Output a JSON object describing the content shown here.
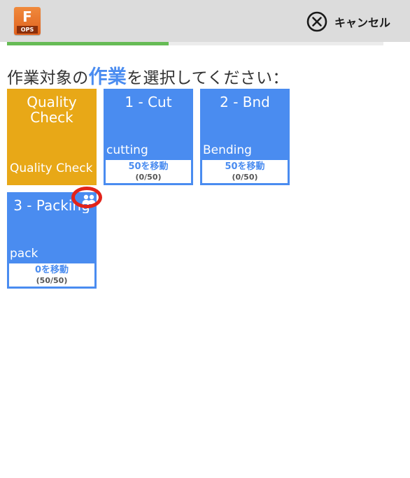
{
  "header": {
    "logo": {
      "letter": "F",
      "badge": "OPS"
    },
    "cancel_label": "キャンセル",
    "cancel_icon": "close-circle-icon"
  },
  "progress": {
    "fraction": 0.43,
    "color": "#66bb55"
  },
  "prompt": {
    "before": "作業対象の",
    "emphasis": "作業",
    "after": "を選択してください："
  },
  "tiles": [
    {
      "title": "Quality Check",
      "subtitle": "Quality Check",
      "move_label": "",
      "count": "",
      "color": "#e8a817"
    },
    {
      "title": "1 - Cut",
      "subtitle": "cutting",
      "move_label": "50を移動",
      "count": "(0/50)",
      "color": "#4a8cf0"
    },
    {
      "title": "2 - Bnd",
      "subtitle": "Bending",
      "move_label": "50を移動",
      "count": "(0/50)",
      "color": "#4a8cf0"
    },
    {
      "title": "3 - Packing",
      "subtitle": "pack",
      "move_label": "0を移動",
      "count": "(50/50)",
      "color": "#4a8cf0",
      "icon": "group-icon"
    }
  ],
  "colors": {
    "accent": "#4a8cf0",
    "qc": "#e8a817",
    "highlight": "#e2231a"
  }
}
